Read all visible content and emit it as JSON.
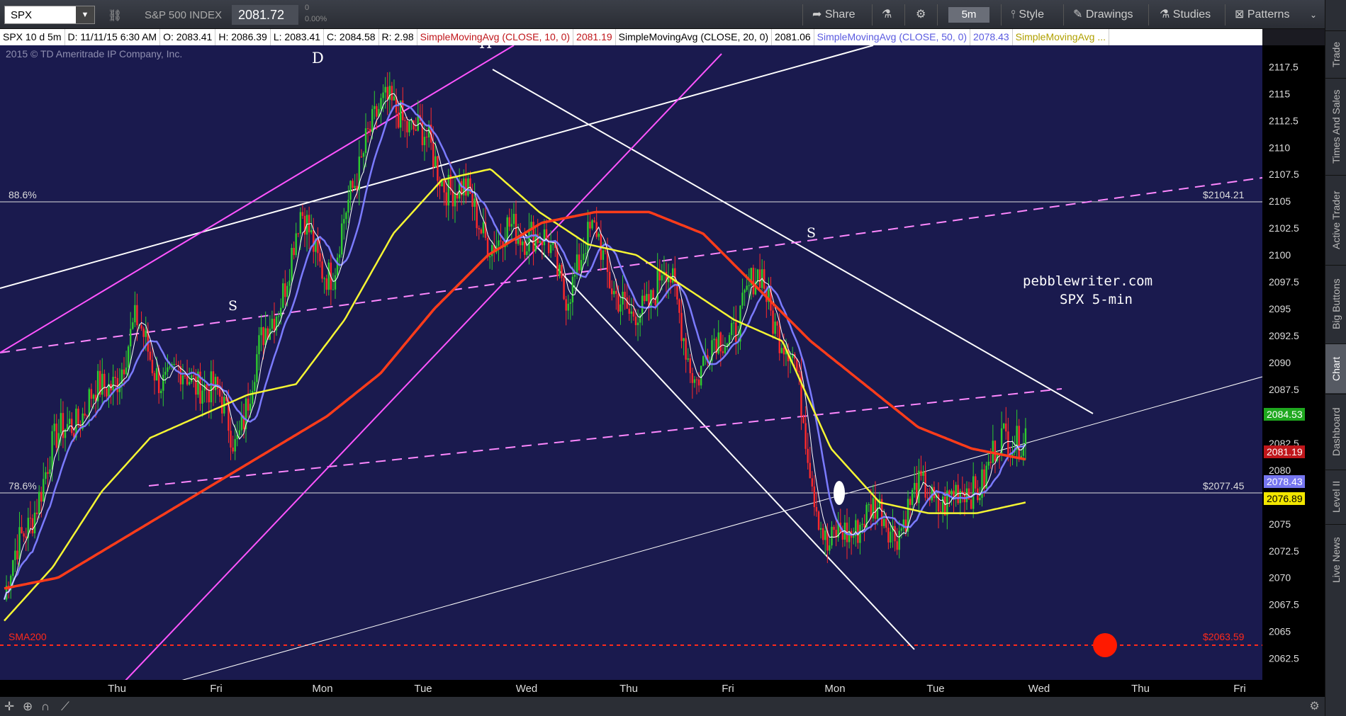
{
  "toolbar": {
    "symbol": "SPX",
    "index_name": "S&P 500 INDEX",
    "price": "2081.72",
    "change": "0",
    "change_pct": "0.00%",
    "share_label": "Share",
    "timeframe": "5m",
    "style_label": "Style",
    "drawings_label": "Drawings",
    "studies_label": "Studies",
    "patterns_label": "Patterns"
  },
  "infobar": {
    "period": "SPX 10 d 5m",
    "date": "D: 11/11/15 6:30 AM",
    "open": "O: 2083.41",
    "high": "H: 2086.39",
    "low": "L: 2083.41",
    "close": "C: 2084.58",
    "range": "R: 2.98",
    "sma10": "SimpleMovingAvg (CLOSE, 10, 0)",
    "sma10_val": "2081.19",
    "sma20": "SimpleMovingAvg (CLOSE, 20, 0)",
    "sma20_val": "2081.06",
    "sma50": "SimpleMovingAvg (CLOSE, 50, 0)",
    "sma50_val": "2078.43",
    "sma_more": "SimpleMovingAvg ..."
  },
  "chart": {
    "copyright": "2015 © TD Ameritrade IP Company, Inc.",
    "watermark_line1": "pebblewriter.com",
    "watermark_line2": "SPX 5-min",
    "label_d": "D",
    "label_h": "H",
    "label_s1": "S",
    "label_s2": "S",
    "fib_886": "88.6%",
    "fib_786": "78.6%",
    "sma200_label": "SMA200",
    "level_2104": "$2104.21",
    "level_2077": "$2077.45",
    "level_2063": "$2063.59"
  },
  "price_axis": [
    "2117.5",
    "2115",
    "2112.5",
    "2110",
    "2107.5",
    "2105",
    "2102.5",
    "2100",
    "2097.5",
    "2095",
    "2092.5",
    "2090",
    "2087.5",
    "2085",
    "2082.5",
    "2080",
    "2077.5",
    "2075",
    "2072.5",
    "2070",
    "2067.5",
    "2065",
    "2062.5"
  ],
  "price_tags": {
    "last": "2084.53",
    "sma10": "2081.19",
    "sma50": "2078.43",
    "sma_yellow": "2076.89"
  },
  "colors": {
    "chart_bg": "#1a1a4e",
    "sma10": "#ffffff",
    "sma20": "#7b7bff",
    "sma50": "#f5f533",
    "sma200": "#ff3c1a",
    "magenta": "#ff66ff",
    "last_tag": "#1fa81f",
    "sma10_tag": "#c0161b",
    "sma50_tag": "#7676f0",
    "yellow_tag": "#f2e600"
  },
  "x_axis": [
    "Thu",
    "Fri",
    "Mon",
    "Tue",
    "Wed",
    "Thu",
    "Fri",
    "Mon",
    "Tue",
    "Wed",
    "Thu",
    "Fri"
  ],
  "right_tabs": [
    "Trade",
    "Times And Sales",
    "Active Trader",
    "Big Buttons",
    "Chart",
    "Dashboard",
    "Level II",
    "Live News"
  ],
  "chart_data": {
    "type": "candlestick",
    "title": "SPX 5-min",
    "x_labels": [
      "Thu",
      "Fri",
      "Mon",
      "Tue",
      "Wed",
      "Thu",
      "Fri",
      "Mon",
      "Tue",
      "Wed"
    ],
    "close_trace": [
      2068,
      2078,
      2085,
      2087,
      2093,
      2088,
      2089,
      2083,
      2093,
      2103,
      2098,
      2112,
      2114,
      2109,
      2105,
      2101,
      2103,
      2097,
      2102,
      2093,
      2099,
      2089,
      2093,
      2098,
      2089,
      2072,
      2076,
      2075,
      2078,
      2077,
      2081,
      2084.5
    ],
    "sma_yellow_trace": [
      2066,
      2071,
      2078,
      2083,
      2085,
      2087,
      2088,
      2094,
      2102,
      2107,
      2108,
      2104,
      2101,
      2100,
      2097,
      2094,
      2092,
      2082,
      2077,
      2076,
      2076,
      2077
    ],
    "sma200_trace": [
      2069,
      2070,
      2073,
      2076,
      2079,
      2082,
      2085,
      2089,
      2095,
      2100,
      2103,
      2104,
      2104,
      2102,
      2097,
      2092,
      2088,
      2084,
      2082,
      2081
    ],
    "levels": {
      "fib_88_6": 2104.21,
      "fib_78_6": 2077.45,
      "sma200": 2063.59
    },
    "y_range": [
      2060.5,
      2119.5
    ]
  }
}
